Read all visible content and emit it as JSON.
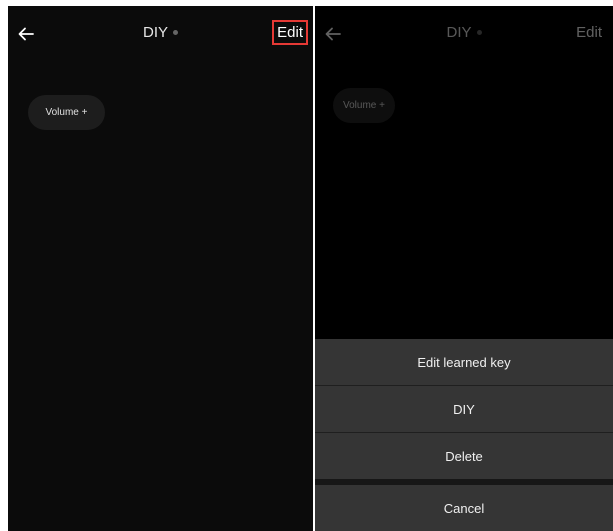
{
  "left_screen": {
    "title": "DIY",
    "edit_label": "Edit",
    "key_button_label": "Volume +"
  },
  "right_screen": {
    "title": "DIY",
    "edit_label": "Edit",
    "key_button_label": "Volume +",
    "action_sheet": {
      "items": [
        {
          "label": "Edit learned key"
        },
        {
          "label": "DIY"
        },
        {
          "label": "Delete"
        }
      ],
      "cancel_label": "Cancel"
    }
  },
  "colors": {
    "background": "#0b0b0b",
    "highlight_border": "#e53935",
    "sheet_item": "#353535"
  }
}
